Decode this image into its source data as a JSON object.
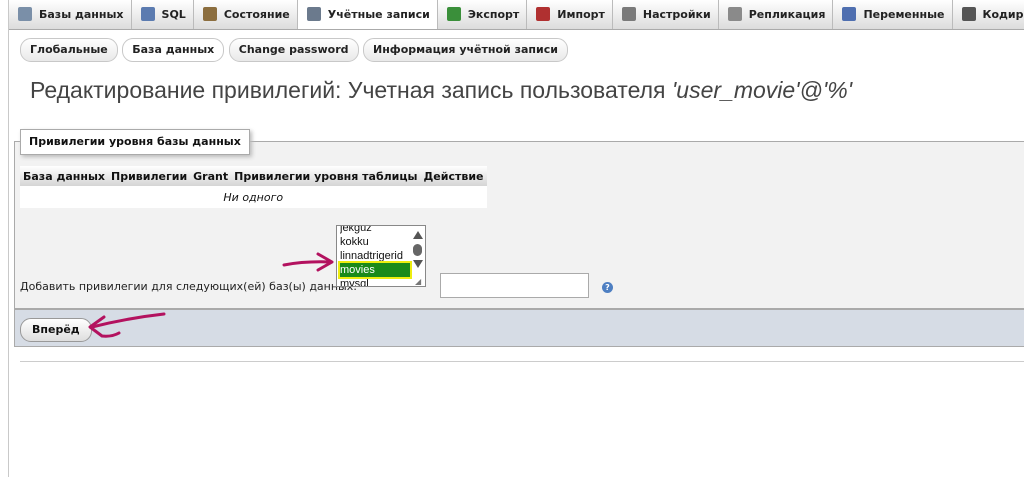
{
  "topnav": {
    "tabs": [
      {
        "label": "Базы данных",
        "icon": "database-icon",
        "color": "#7a8fa8"
      },
      {
        "label": "SQL",
        "icon": "sql-icon",
        "color": "#5b7bb0"
      },
      {
        "label": "Состояние",
        "icon": "status-icon",
        "color": "#8c6e3f"
      },
      {
        "label": "Учётные записи",
        "icon": "users-icon",
        "color": "#6b7a8d",
        "active": true
      },
      {
        "label": "Экспорт",
        "icon": "export-icon",
        "color": "#3a8f3a"
      },
      {
        "label": "Импорт",
        "icon": "import-icon",
        "color": "#b03030"
      },
      {
        "label": "Настройки",
        "icon": "wrench-icon",
        "color": "#7a7a7a"
      },
      {
        "label": "Репликация",
        "icon": "replication-icon",
        "color": "#8a8a8a"
      },
      {
        "label": "Переменные",
        "icon": "variables-icon",
        "color": "#4f6fb0"
      },
      {
        "label": "Кодировки",
        "icon": "charset-icon",
        "color": "#555555"
      }
    ]
  },
  "subtabs": [
    {
      "label": "Глобальные"
    },
    {
      "label": "База данных",
      "active": true
    },
    {
      "label": "Change password"
    },
    {
      "label": "Информация учётной записи"
    }
  ],
  "page_title": {
    "prefix": "Редактирование привилегий: Учетная запись пользователя",
    "account": "'user_movie'@'%'"
  },
  "section": {
    "legend": "Привилегии уровня базы данных",
    "columns": [
      "База данных",
      "Привилегии",
      "Grant",
      "Привилегии уровня таблицы",
      "Действие"
    ],
    "empty_text": "Ни одного"
  },
  "add_privileges": {
    "label": "Добавить привилегии для следующих(ей) баз(ы) данных:",
    "databases": [
      "jekguz",
      "kokku",
      "linnadtrigerid",
      "movies",
      "mysql"
    ],
    "selected": "movies",
    "input_value": "",
    "help_icon": "help-icon"
  },
  "actions": {
    "go_label": "Вперёд"
  },
  "annotations": {
    "color": "#b3125f",
    "highlight": "#eded10"
  }
}
